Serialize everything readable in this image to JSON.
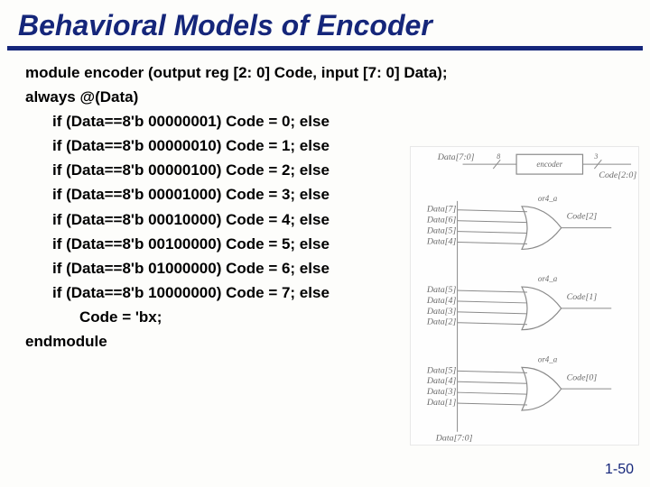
{
  "title": "Behavioral Models of Encoder",
  "code": {
    "declaration": "module encoder (output reg [2: 0] Code, input [7: 0] Data);",
    "always": "always @(Data)",
    "ifs": [
      "if (Data==8'b 00000001)  Code = 0; else",
      "if (Data==8'b 00000010)  Code = 1; else",
      "if (Data==8'b 00000100)  Code = 2; else",
      "if (Data==8'b 00001000)  Code = 3; else",
      "if (Data==8'b 00010000)  Code = 4; else",
      "if (Data==8'b 00100000)  Code = 5; else",
      "if (Data==8'b 01000000)  Code = 6; else",
      "if (Data==8'b 10000000)  Code = 7; else"
    ],
    "default": "Code = 'bx;",
    "end": "endmodule"
  },
  "diagram": {
    "bus_in_label": "Data[7:0]",
    "bus_in_width": "8",
    "encoder_label": "encoder",
    "bus_out_width": "3",
    "bus_out_label": "Code[2:0]",
    "gates": [
      "or4_a",
      "or4_a",
      "or4_a"
    ],
    "data_labels": [
      "Data[7]",
      "Data[6]",
      "Data[5]",
      "Data[4]",
      "Data[5]",
      "Data[4]",
      "Data[3]",
      "Data[2]",
      "Data[5]",
      "Data[4]",
      "Data[3]",
      "Data[1]"
    ],
    "code_labels": [
      "Code[2]",
      "Code[1]",
      "Code[0]"
    ],
    "bottom_bus": "Data[7:0]"
  },
  "page_num": "1-50"
}
